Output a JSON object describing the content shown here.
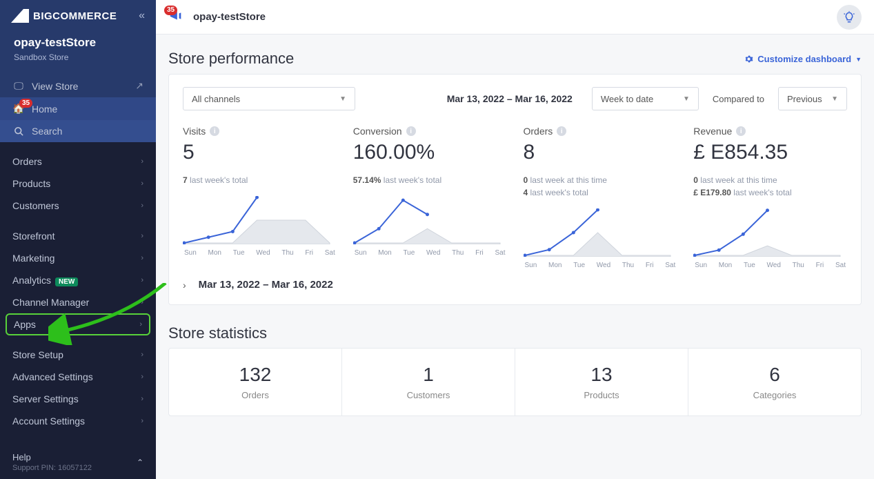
{
  "brand": "BIGCOMMERCE",
  "store": {
    "name": "opay-testStore",
    "sub": "Sandbox Store"
  },
  "sidebar": {
    "view_store": "View Store",
    "home": "Home",
    "home_badge": "35",
    "search": "Search",
    "items": [
      {
        "label": "Orders"
      },
      {
        "label": "Products"
      },
      {
        "label": "Customers"
      }
    ],
    "items2": [
      {
        "label": "Storefront"
      },
      {
        "label": "Marketing"
      },
      {
        "label": "Analytics",
        "new": "NEW"
      },
      {
        "label": "Channel Manager"
      }
    ],
    "apps": "Apps",
    "items3": [
      {
        "label": "Store Setup"
      },
      {
        "label": "Advanced Settings"
      },
      {
        "label": "Server Settings"
      },
      {
        "label": "Account Settings"
      }
    ],
    "help": "Help",
    "pin": "Support PIN: 16057122"
  },
  "topbar": {
    "badge": "35",
    "title": "opay-testStore"
  },
  "perf": {
    "heading": "Store performance",
    "customize": "Customize dashboard",
    "channels": "All channels",
    "date_range": "Mar 13, 2022 – Mar 16, 2022",
    "period": "Week to date",
    "compared_label": "Compared to",
    "compared_value": "Previous",
    "metrics": [
      {
        "label": "Visits",
        "value": "5",
        "notes": [
          {
            "b": "7",
            "t": " last week's total"
          }
        ]
      },
      {
        "label": "Conversion",
        "value": "160.00%",
        "notes": [
          {
            "b": "57.14%",
            "t": " last week's total"
          }
        ]
      },
      {
        "label": "Orders",
        "value": "8",
        "notes": [
          {
            "b": "0",
            "t": " last week at this time"
          },
          {
            "b": "4",
            "t": " last week's total"
          }
        ]
      },
      {
        "label": "Revenue",
        "value": "£ E854.35",
        "notes": [
          {
            "b": "0",
            "t": " last week at this time"
          },
          {
            "b": "£ E179.80",
            "t": " last week's total"
          }
        ]
      }
    ],
    "days": [
      "Sun",
      "Mon",
      "Tue",
      "Wed",
      "Thu",
      "Fri",
      "Sat"
    ],
    "expand_range": "Mar 13, 2022 – Mar 16, 2022"
  },
  "stats": {
    "heading": "Store statistics",
    "items": [
      {
        "value": "132",
        "label": "Orders"
      },
      {
        "value": "1",
        "label": "Customers"
      },
      {
        "value": "13",
        "label": "Products"
      },
      {
        "value": "6",
        "label": "Categories"
      }
    ]
  },
  "chart_data": [
    {
      "type": "line",
      "title": "Visits",
      "categories": [
        "Sun",
        "Mon",
        "Tue",
        "Wed",
        "Thu",
        "Fri",
        "Sat"
      ],
      "series": [
        {
          "name": "previous",
          "values": [
            0,
            0,
            0,
            2,
            2,
            2,
            0
          ],
          "style": "area-grey"
        },
        {
          "name": "current",
          "values": [
            0,
            0.5,
            1,
            4,
            null,
            null,
            null
          ],
          "style": "line-blue"
        }
      ],
      "ylim": [
        0,
        4
      ]
    },
    {
      "type": "line",
      "title": "Conversion",
      "categories": [
        "Sun",
        "Mon",
        "Tue",
        "Wed",
        "Thu",
        "Fri",
        "Sat"
      ],
      "series": [
        {
          "name": "previous",
          "values": [
            0,
            0,
            0,
            50,
            0,
            0,
            0
          ],
          "style": "area-grey"
        },
        {
          "name": "current",
          "values": [
            0,
            50,
            150,
            100,
            null,
            null,
            null
          ],
          "style": "line-blue"
        }
      ],
      "ylim": [
        0,
        160
      ]
    },
    {
      "type": "line",
      "title": "Orders",
      "categories": [
        "Sun",
        "Mon",
        "Tue",
        "Wed",
        "Thu",
        "Fri",
        "Sat"
      ],
      "series": [
        {
          "name": "previous",
          "values": [
            0,
            0,
            0,
            4,
            0,
            0,
            0
          ],
          "style": "area-grey"
        },
        {
          "name": "current",
          "values": [
            0,
            1,
            4,
            8,
            null,
            null,
            null
          ],
          "style": "line-blue"
        }
      ],
      "ylim": [
        0,
        8
      ]
    },
    {
      "type": "line",
      "title": "Revenue",
      "categories": [
        "Sun",
        "Mon",
        "Tue",
        "Wed",
        "Thu",
        "Fri",
        "Sat"
      ],
      "series": [
        {
          "name": "previous",
          "values": [
            0,
            0,
            0,
            180,
            0,
            0,
            0
          ],
          "style": "area-grey"
        },
        {
          "name": "current",
          "values": [
            0,
            100,
            400,
            850,
            null,
            null,
            null
          ],
          "style": "line-blue"
        }
      ],
      "ylim": [
        0,
        860
      ]
    }
  ]
}
